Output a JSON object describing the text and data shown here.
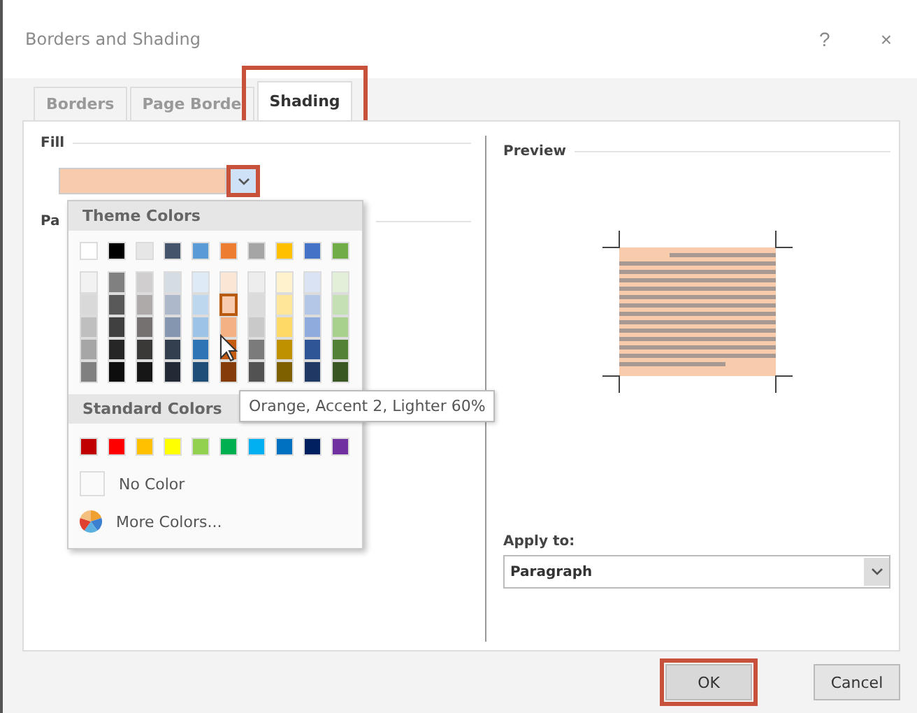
{
  "window": {
    "title": "Borders and Shading",
    "help": "?",
    "close": "×"
  },
  "tabs": [
    {
      "label": "Borders",
      "selected": false,
      "highlighted": false
    },
    {
      "label": "Page Borde",
      "selected": false,
      "highlighted": false
    },
    {
      "label": "Shading",
      "selected": true,
      "highlighted": true
    }
  ],
  "fill": {
    "label": "Fill",
    "color": "#f7cbac",
    "dropdown_highlighted": true
  },
  "pattern": {
    "label": "Pa"
  },
  "color_menu": {
    "theme_header": "Theme Colors",
    "theme_colors": [
      [
        {
          "color": "#ffffff",
          "selected": false
        },
        {
          "color": "#000000",
          "selected": false
        },
        {
          "color": "#e7e6e6",
          "selected": false
        },
        {
          "color": "#44546a",
          "selected": false
        },
        {
          "color": "#5b9bd5",
          "selected": false
        },
        {
          "color": "#ed7d31",
          "selected": false
        },
        {
          "color": "#a5a5a5",
          "selected": false
        },
        {
          "color": "#ffc000",
          "selected": false
        },
        {
          "color": "#4472c4",
          "selected": false
        },
        {
          "color": "#70ad47",
          "selected": false
        }
      ],
      [
        {
          "color": "#f2f2f2",
          "selected": false
        },
        {
          "color": "#808080",
          "selected": false
        },
        {
          "color": "#d0cece",
          "selected": false
        },
        {
          "color": "#d6dce4",
          "selected": false
        },
        {
          "color": "#deebf6",
          "selected": false
        },
        {
          "color": "#fbe5d5",
          "selected": false
        },
        {
          "color": "#ededed",
          "selected": false
        },
        {
          "color": "#fff2cc",
          "selected": false
        },
        {
          "color": "#dae3f3",
          "selected": false
        },
        {
          "color": "#e2f0d9",
          "selected": false
        }
      ],
      [
        {
          "color": "#d9d9d9",
          "selected": false
        },
        {
          "color": "#595959",
          "selected": false
        },
        {
          "color": "#aeaaaa",
          "selected": false
        },
        {
          "color": "#adb9ca",
          "selected": false
        },
        {
          "color": "#bdd7ee",
          "selected": false
        },
        {
          "color": "#f7cbac",
          "selected": true
        },
        {
          "color": "#dbdbdb",
          "selected": false
        },
        {
          "color": "#ffe699",
          "selected": false
        },
        {
          "color": "#b4c7e7",
          "selected": false
        },
        {
          "color": "#c5e0b4",
          "selected": false
        }
      ],
      [
        {
          "color": "#bfbfbf",
          "selected": false
        },
        {
          "color": "#404040",
          "selected": false
        },
        {
          "color": "#767171",
          "selected": false
        },
        {
          "color": "#8496b0",
          "selected": false
        },
        {
          "color": "#9dc3e6",
          "selected": false
        },
        {
          "color": "#f4b183",
          "selected": false
        },
        {
          "color": "#c9c9c9",
          "selected": false
        },
        {
          "color": "#ffd966",
          "selected": false
        },
        {
          "color": "#8faadc",
          "selected": false
        },
        {
          "color": "#a9d18e",
          "selected": false
        }
      ],
      [
        {
          "color": "#a6a6a6",
          "selected": false
        },
        {
          "color": "#262626",
          "selected": false
        },
        {
          "color": "#3b3838",
          "selected": false
        },
        {
          "color": "#333f4f",
          "selected": false
        },
        {
          "color": "#2e75b5",
          "selected": false
        },
        {
          "color": "#c55a11",
          "selected": false
        },
        {
          "color": "#7b7b7b",
          "selected": false
        },
        {
          "color": "#bf9000",
          "selected": false
        },
        {
          "color": "#2f5597",
          "selected": false
        },
        {
          "color": "#538135",
          "selected": false
        }
      ],
      [
        {
          "color": "#808080",
          "selected": false
        },
        {
          "color": "#0d0d0d",
          "selected": false
        },
        {
          "color": "#171616",
          "selected": false
        },
        {
          "color": "#222a35",
          "selected": false
        },
        {
          "color": "#1f4e79",
          "selected": false
        },
        {
          "color": "#843c0b",
          "selected": false
        },
        {
          "color": "#525252",
          "selected": false
        },
        {
          "color": "#7f6000",
          "selected": false
        },
        {
          "color": "#203864",
          "selected": false
        },
        {
          "color": "#385723",
          "selected": false
        }
      ]
    ],
    "standard_header": "Standard Colors",
    "standard_colors": [
      {
        "color": "#c00000"
      },
      {
        "color": "#ff0000"
      },
      {
        "color": "#ffc000"
      },
      {
        "color": "#ffff00"
      },
      {
        "color": "#92d050"
      },
      {
        "color": "#00b050"
      },
      {
        "color": "#00b0f0"
      },
      {
        "color": "#0070c0"
      },
      {
        "color": "#002060"
      },
      {
        "color": "#7030a0"
      }
    ],
    "no_color": "No Color",
    "more_colors": "More Colors..."
  },
  "tooltip": "Orange, Accent 2, Lighter 60%",
  "preview": {
    "label": "Preview"
  },
  "apply_to": {
    "label": "Apply to:",
    "value": "Paragraph"
  },
  "buttons": [
    {
      "label": "OK",
      "highlighted": true
    },
    {
      "label": "Cancel",
      "highlighted": false
    }
  ]
}
